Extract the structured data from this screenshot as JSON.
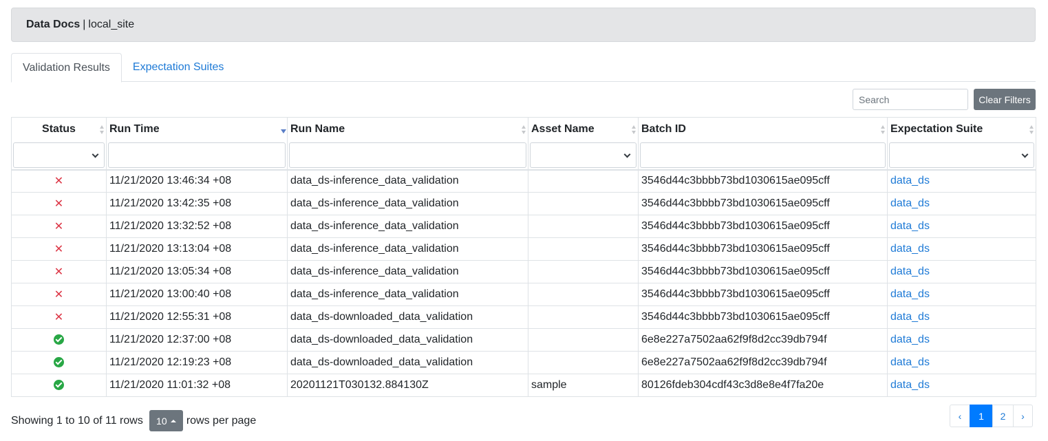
{
  "navbar": {
    "brand": "Data Docs",
    "separator": "|",
    "site": "local_site"
  },
  "tabs": [
    {
      "label": "Validation Results",
      "active": true
    },
    {
      "label": "Expectation Suites",
      "active": false
    }
  ],
  "toolbar": {
    "search_placeholder": "Search",
    "clear_label": "Clear Filters"
  },
  "table": {
    "columns": [
      "Status",
      "Run Time",
      "Run Name",
      "Asset Name",
      "Batch ID",
      "Expectation Suite"
    ],
    "rows": [
      {
        "status": "failed",
        "run_time": "11/21/2020 13:46:34 +08",
        "run_name": "data_ds-inference_data_validation",
        "asset_name": "",
        "batch_id": "3546d44c3bbbb73bd1030615ae095cff",
        "suite": "data_ds"
      },
      {
        "status": "failed",
        "run_time": "11/21/2020 13:42:35 +08",
        "run_name": "data_ds-inference_data_validation",
        "asset_name": "",
        "batch_id": "3546d44c3bbbb73bd1030615ae095cff",
        "suite": "data_ds"
      },
      {
        "status": "failed",
        "run_time": "11/21/2020 13:32:52 +08",
        "run_name": "data_ds-inference_data_validation",
        "asset_name": "",
        "batch_id": "3546d44c3bbbb73bd1030615ae095cff",
        "suite": "data_ds"
      },
      {
        "status": "failed",
        "run_time": "11/21/2020 13:13:04 +08",
        "run_name": "data_ds-inference_data_validation",
        "asset_name": "",
        "batch_id": "3546d44c3bbbb73bd1030615ae095cff",
        "suite": "data_ds"
      },
      {
        "status": "failed",
        "run_time": "11/21/2020 13:05:34 +08",
        "run_name": "data_ds-inference_data_validation",
        "asset_name": "",
        "batch_id": "3546d44c3bbbb73bd1030615ae095cff",
        "suite": "data_ds"
      },
      {
        "status": "failed",
        "run_time": "11/21/2020 13:00:40 +08",
        "run_name": "data_ds-inference_data_validation",
        "asset_name": "",
        "batch_id": "3546d44c3bbbb73bd1030615ae095cff",
        "suite": "data_ds"
      },
      {
        "status": "failed",
        "run_time": "11/21/2020 12:55:31 +08",
        "run_name": "data_ds-downloaded_data_validation",
        "asset_name": "",
        "batch_id": "3546d44c3bbbb73bd1030615ae095cff",
        "suite": "data_ds"
      },
      {
        "status": "success",
        "run_time": "11/21/2020 12:37:00 +08",
        "run_name": "data_ds-downloaded_data_validation",
        "asset_name": "",
        "batch_id": "6e8e227a7502aa62f9f8d2cc39db794f",
        "suite": "data_ds"
      },
      {
        "status": "success",
        "run_time": "11/21/2020 12:19:23 +08",
        "run_name": "data_ds-downloaded_data_validation",
        "asset_name": "",
        "batch_id": "6e8e227a7502aa62f9f8d2cc39db794f",
        "suite": "data_ds"
      },
      {
        "status": "success",
        "run_time": "11/21/2020 11:01:32 +08",
        "run_name": "20201121T030132.884130Z",
        "asset_name": "sample",
        "batch_id": "80126fdeb304cdf43c3d8e8e4f7fa20e",
        "suite": "data_ds"
      }
    ]
  },
  "footer": {
    "showing_text": "Showing 1 to 10 of 11 rows",
    "page_size": "10",
    "per_page_text": "rows per page"
  },
  "pagination": {
    "prev": "‹",
    "pages": [
      "1",
      "2"
    ],
    "next": "›",
    "current": "1"
  },
  "colors": {
    "failed": "#dc3545",
    "success": "#28a745",
    "link": "#1e7ad6"
  }
}
